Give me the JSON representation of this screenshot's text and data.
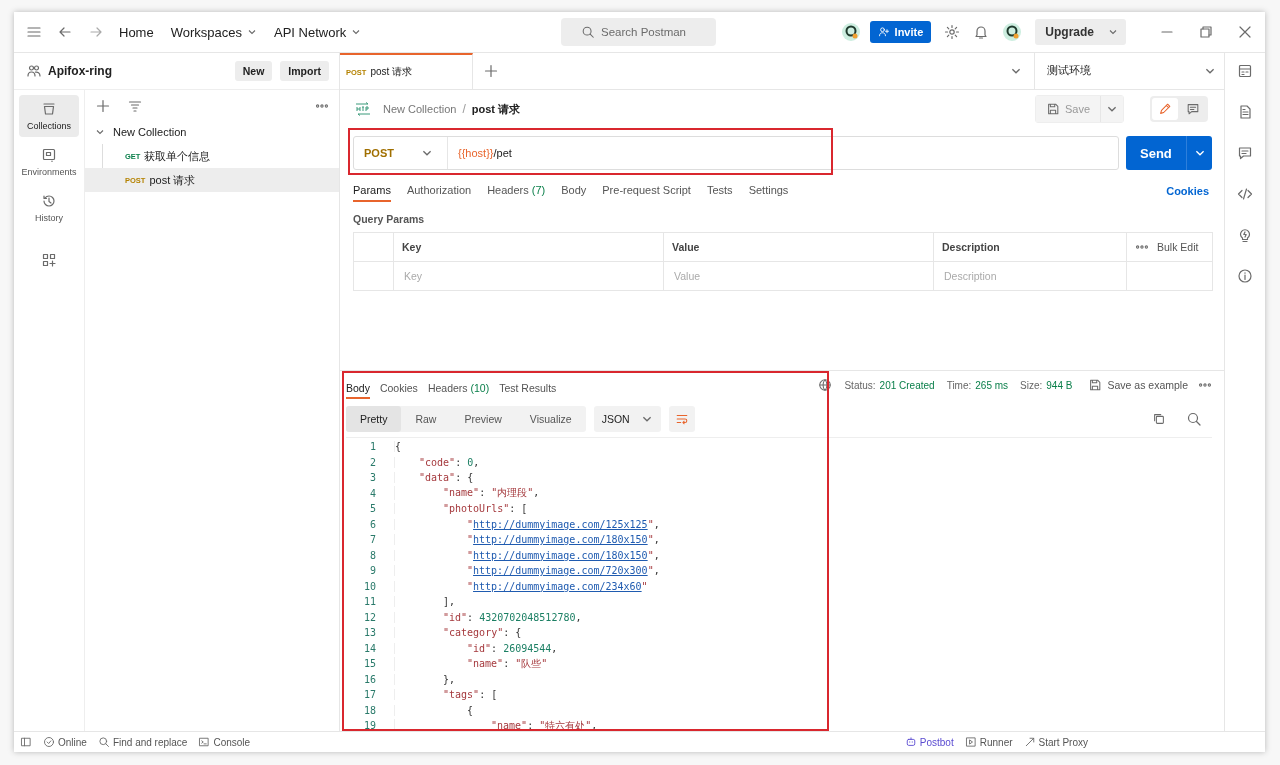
{
  "top_bar": {
    "nav": [
      {
        "label": "Home",
        "dropdown": false
      },
      {
        "label": "Workspaces",
        "dropdown": true
      },
      {
        "label": "API Network",
        "dropdown": true
      }
    ],
    "search": {
      "placeholder": "Search Postman"
    },
    "invite": "Invite",
    "upgrade": "Upgrade"
  },
  "workspace": {
    "name": "Apifox-ring",
    "buttons": [
      "New",
      "Import"
    ]
  },
  "sidebar": {
    "items": [
      {
        "kind": "collections",
        "label": "Collections",
        "selected": true
      },
      {
        "kind": "environments",
        "label": "Environments",
        "selected": false
      },
      {
        "kind": "history",
        "label": "History",
        "selected": false
      },
      {
        "kind": "apps",
        "selected": false
      }
    ]
  },
  "tree": [
    {
      "name": "New Collection",
      "expanded": true,
      "children": [
        {
          "method": "GET",
          "name": "获取单个信息",
          "selected": false
        },
        {
          "method": "POST",
          "name": "post 请求",
          "selected": true
        }
      ]
    }
  ],
  "tabs": [
    {
      "method": "POST",
      "label": "post 请求",
      "selected": true
    }
  ],
  "environment": "测试环境",
  "breadcrumb": {
    "collection": "New Collection",
    "separator": "/",
    "request": "post 请求"
  },
  "save": "Save",
  "request": {
    "method": "POST",
    "url_variable": "{{host}}",
    "url_path": "/pet",
    "send": "Send"
  },
  "request_tabs": [
    {
      "label": "Params",
      "selected": true
    },
    {
      "label": "Authorization",
      "selected": false
    },
    {
      "label": "Headers",
      "count": "(7)",
      "selected": false
    },
    {
      "label": "Body",
      "selected": false
    },
    {
      "label": "Pre-request Script",
      "selected": false
    },
    {
      "label": "Tests",
      "selected": false
    },
    {
      "label": "Settings",
      "selected": false
    }
  ],
  "cookies_link": "Cookies",
  "query_params": {
    "title": "Query Params",
    "columns": [
      "Key",
      "Value",
      "Description"
    ],
    "bulk_edit": "Bulk Edit",
    "placeholders": [
      "Key",
      "Value",
      "Description"
    ]
  },
  "response": {
    "tabs": [
      {
        "label": "Body",
        "selected": true
      },
      {
        "label": "Cookies",
        "selected": false
      },
      {
        "label": "Headers",
        "count": "(10)",
        "selected": false
      },
      {
        "label": "Test Results",
        "selected": false
      }
    ],
    "status_label": "Status:",
    "status": "201 Created",
    "time_label": "Time:",
    "time": "265 ms",
    "size_label": "Size:",
    "size": "944 B",
    "save_example": "Save as example",
    "views": [
      {
        "label": "Pretty",
        "selected": true
      },
      {
        "label": "Raw",
        "selected": false
      },
      {
        "label": "Preview",
        "selected": false
      },
      {
        "label": "Visualize",
        "selected": false
      }
    ],
    "format": "JSON",
    "lines": [
      {
        "number": "1",
        "tokens": [
          {
            "kind": "punct",
            "text": "{"
          }
        ],
        "children": [
          {
            "number": "2",
            "tokens": [
              {
                "kind": "key",
                "text": "\"code\""
              },
              {
                "kind": "punct",
                "text": ": "
              },
              {
                "kind": "number",
                "text": "0"
              },
              {
                "kind": "punct",
                "text": ","
              }
            ]
          },
          {
            "number": "3",
            "tokens": [
              {
                "kind": "key",
                "text": "\"data\""
              },
              {
                "kind": "punct",
                "text": ": {"
              }
            ],
            "children": [
              {
                "number": "4",
                "tokens": [
                  {
                    "kind": "key",
                    "text": "\"name\""
                  },
                  {
                    "kind": "punct",
                    "text": ": "
                  },
                  {
                    "kind": "string",
                    "text": "\"内理段\""
                  },
                  {
                    "kind": "punct",
                    "text": ","
                  }
                ]
              },
              {
                "number": "5",
                "tokens": [
                  {
                    "kind": "key",
                    "text": "\"photoUrls\""
                  },
                  {
                    "kind": "punct",
                    "text": ": ["
                  }
                ],
                "children": [
                  {
                    "number": "6",
                    "tokens": [
                      {
                        "kind": "string",
                        "text": "\""
                      },
                      {
                        "kind": "link",
                        "text": "http://dummyimage.com/125x125"
                      },
                      {
                        "kind": "string",
                        "text": "\""
                      },
                      {
                        "kind": "punct",
                        "text": ","
                      }
                    ]
                  },
                  {
                    "number": "7",
                    "tokens": [
                      {
                        "kind": "string",
                        "text": "\""
                      },
                      {
                        "kind": "link",
                        "text": "http://dummyimage.com/180x150"
                      },
                      {
                        "kind": "string",
                        "text": "\""
                      },
                      {
                        "kind": "punct",
                        "text": ","
                      }
                    ]
                  },
                  {
                    "number": "8",
                    "tokens": [
                      {
                        "kind": "string",
                        "text": "\""
                      },
                      {
                        "kind": "link",
                        "text": "http://dummyimage.com/180x150"
                      },
                      {
                        "kind": "string",
                        "text": "\""
                      },
                      {
                        "kind": "punct",
                        "text": ","
                      }
                    ]
                  },
                  {
                    "number": "9",
                    "tokens": [
                      {
                        "kind": "string",
                        "text": "\""
                      },
                      {
                        "kind": "link",
                        "text": "http://dummyimage.com/720x300"
                      },
                      {
                        "kind": "string",
                        "text": "\""
                      },
                      {
                        "kind": "punct",
                        "text": ","
                      }
                    ]
                  },
                  {
                    "number": "10",
                    "tokens": [
                      {
                        "kind": "string",
                        "text": "\""
                      },
                      {
                        "kind": "link",
                        "text": "http://dummyimage.com/234x60"
                      },
                      {
                        "kind": "string",
                        "text": "\""
                      }
                    ]
                  }
                ]
              },
              {
                "number": "11",
                "tokens": [
                  {
                    "kind": "punct",
                    "text": "],"
                  }
                ]
              },
              {
                "number": "12",
                "tokens": [
                  {
                    "kind": "key",
                    "text": "\"id\""
                  },
                  {
                    "kind": "punct",
                    "text": ": "
                  },
                  {
                    "kind": "number",
                    "text": "4320702048512780"
                  },
                  {
                    "kind": "punct",
                    "text": ","
                  }
                ]
              },
              {
                "number": "13",
                "tokens": [
                  {
                    "kind": "key",
                    "text": "\"category\""
                  },
                  {
                    "kind": "punct",
                    "text": ": {"
                  }
                ],
                "children": [
                  {
                    "number": "14",
                    "tokens": [
                      {
                        "kind": "key",
                        "text": "\"id\""
                      },
                      {
                        "kind": "punct",
                        "text": ": "
                      },
                      {
                        "kind": "number",
                        "text": "26094544"
                      },
                      {
                        "kind": "punct",
                        "text": ","
                      }
                    ]
                  },
                  {
                    "number": "15",
                    "tokens": [
                      {
                        "kind": "key",
                        "text": "\"name\""
                      },
                      {
                        "kind": "punct",
                        "text": ": "
                      },
                      {
                        "kind": "string",
                        "text": "\"队些\""
                      }
                    ]
                  }
                ]
              },
              {
                "number": "16",
                "tokens": [
                  {
                    "kind": "punct",
                    "text": "},"
                  }
                ]
              },
              {
                "number": "17",
                "tokens": [
                  {
                    "kind": "key",
                    "text": "\"tags\""
                  },
                  {
                    "kind": "punct",
                    "text": ": ["
                  }
                ],
                "children": [
                  {
                    "number": "18",
                    "tokens": [
                      {
                        "kind": "punct",
                        "text": "{"
                      }
                    ],
                    "children": [
                      {
                        "number": "19",
                        "tokens": [
                          {
                            "kind": "key",
                            "text": "\"name\""
                          },
                          {
                            "kind": "punct",
                            "text": ": "
                          },
                          {
                            "kind": "string",
                            "text": "\"特六有处\""
                          },
                          {
                            "kind": "punct",
                            "text": ","
                          }
                        ]
                      }
                    ]
                  }
                ]
              }
            ]
          }
        ]
      }
    ]
  },
  "highlights": {
    "request_line": true,
    "response_body": true
  },
  "status_bar": {
    "left": [
      {
        "kind": "online",
        "label": "Online"
      },
      {
        "kind": "find",
        "label": "Find and replace"
      },
      {
        "kind": "console",
        "label": "Console"
      }
    ],
    "right": [
      {
        "kind": "postbot",
        "label": "Postbot"
      },
      {
        "kind": "runner",
        "label": "Runner"
      },
      {
        "kind": "proxy",
        "label": "Start Proxy"
      }
    ]
  }
}
